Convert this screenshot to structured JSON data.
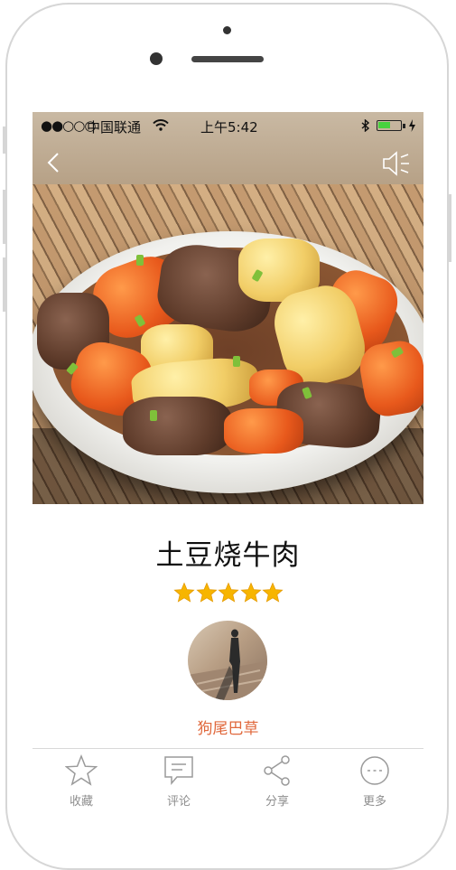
{
  "status_bar": {
    "signal": "●●○○○",
    "carrier": "中国联通",
    "time": "上午5:42"
  },
  "hero": {
    "image_alt": "土豆烧牛肉 dish photo"
  },
  "recipe": {
    "title": "土豆烧牛肉",
    "rating": 5,
    "rating_max": 5,
    "author": "狗尾巴草"
  },
  "icons": {
    "back": "chevron-left-icon",
    "sound": "speaker-icon",
    "star": "star-icon"
  },
  "colors": {
    "author": "#e0683c",
    "star": "#f7b500",
    "tab_text": "#8e8e8e",
    "battery": "#47d13e"
  },
  "tabbar": {
    "items": [
      {
        "label": "收藏",
        "icon": "star-outline-icon"
      },
      {
        "label": "评论",
        "icon": "comment-icon"
      },
      {
        "label": "分享",
        "icon": "share-icon"
      },
      {
        "label": "更多",
        "icon": "more-icon"
      }
    ]
  }
}
